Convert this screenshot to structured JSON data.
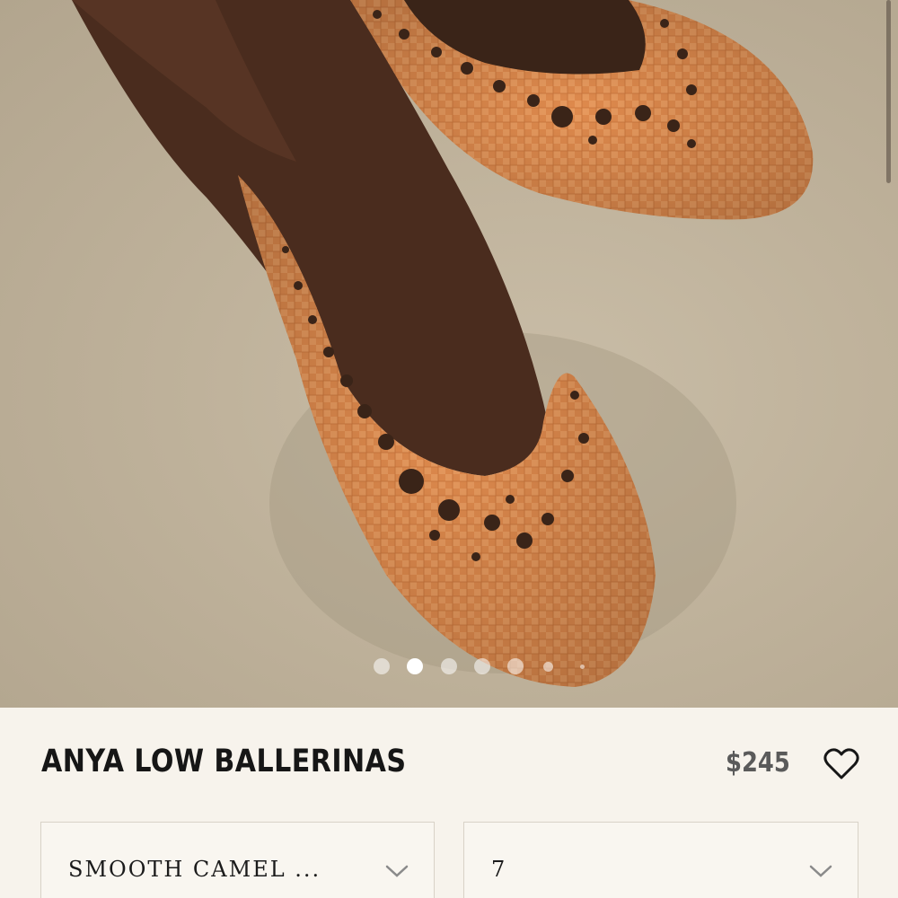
{
  "product": {
    "title": "ANYA LOW BALLERINAS",
    "price": "$245"
  },
  "gallery": {
    "slide_count": 7,
    "active_index": 1
  },
  "options": {
    "color": {
      "selected": "SMOOTH CAMEL ..."
    },
    "size": {
      "selected": "7"
    }
  },
  "icons": {
    "favorite": "heart-icon",
    "dropdown": "chevron-down-icon"
  },
  "colors": {
    "background": "#f7f3ec",
    "shoe": "#e0894a",
    "title": "#161616",
    "price": "#5a5a5a"
  }
}
